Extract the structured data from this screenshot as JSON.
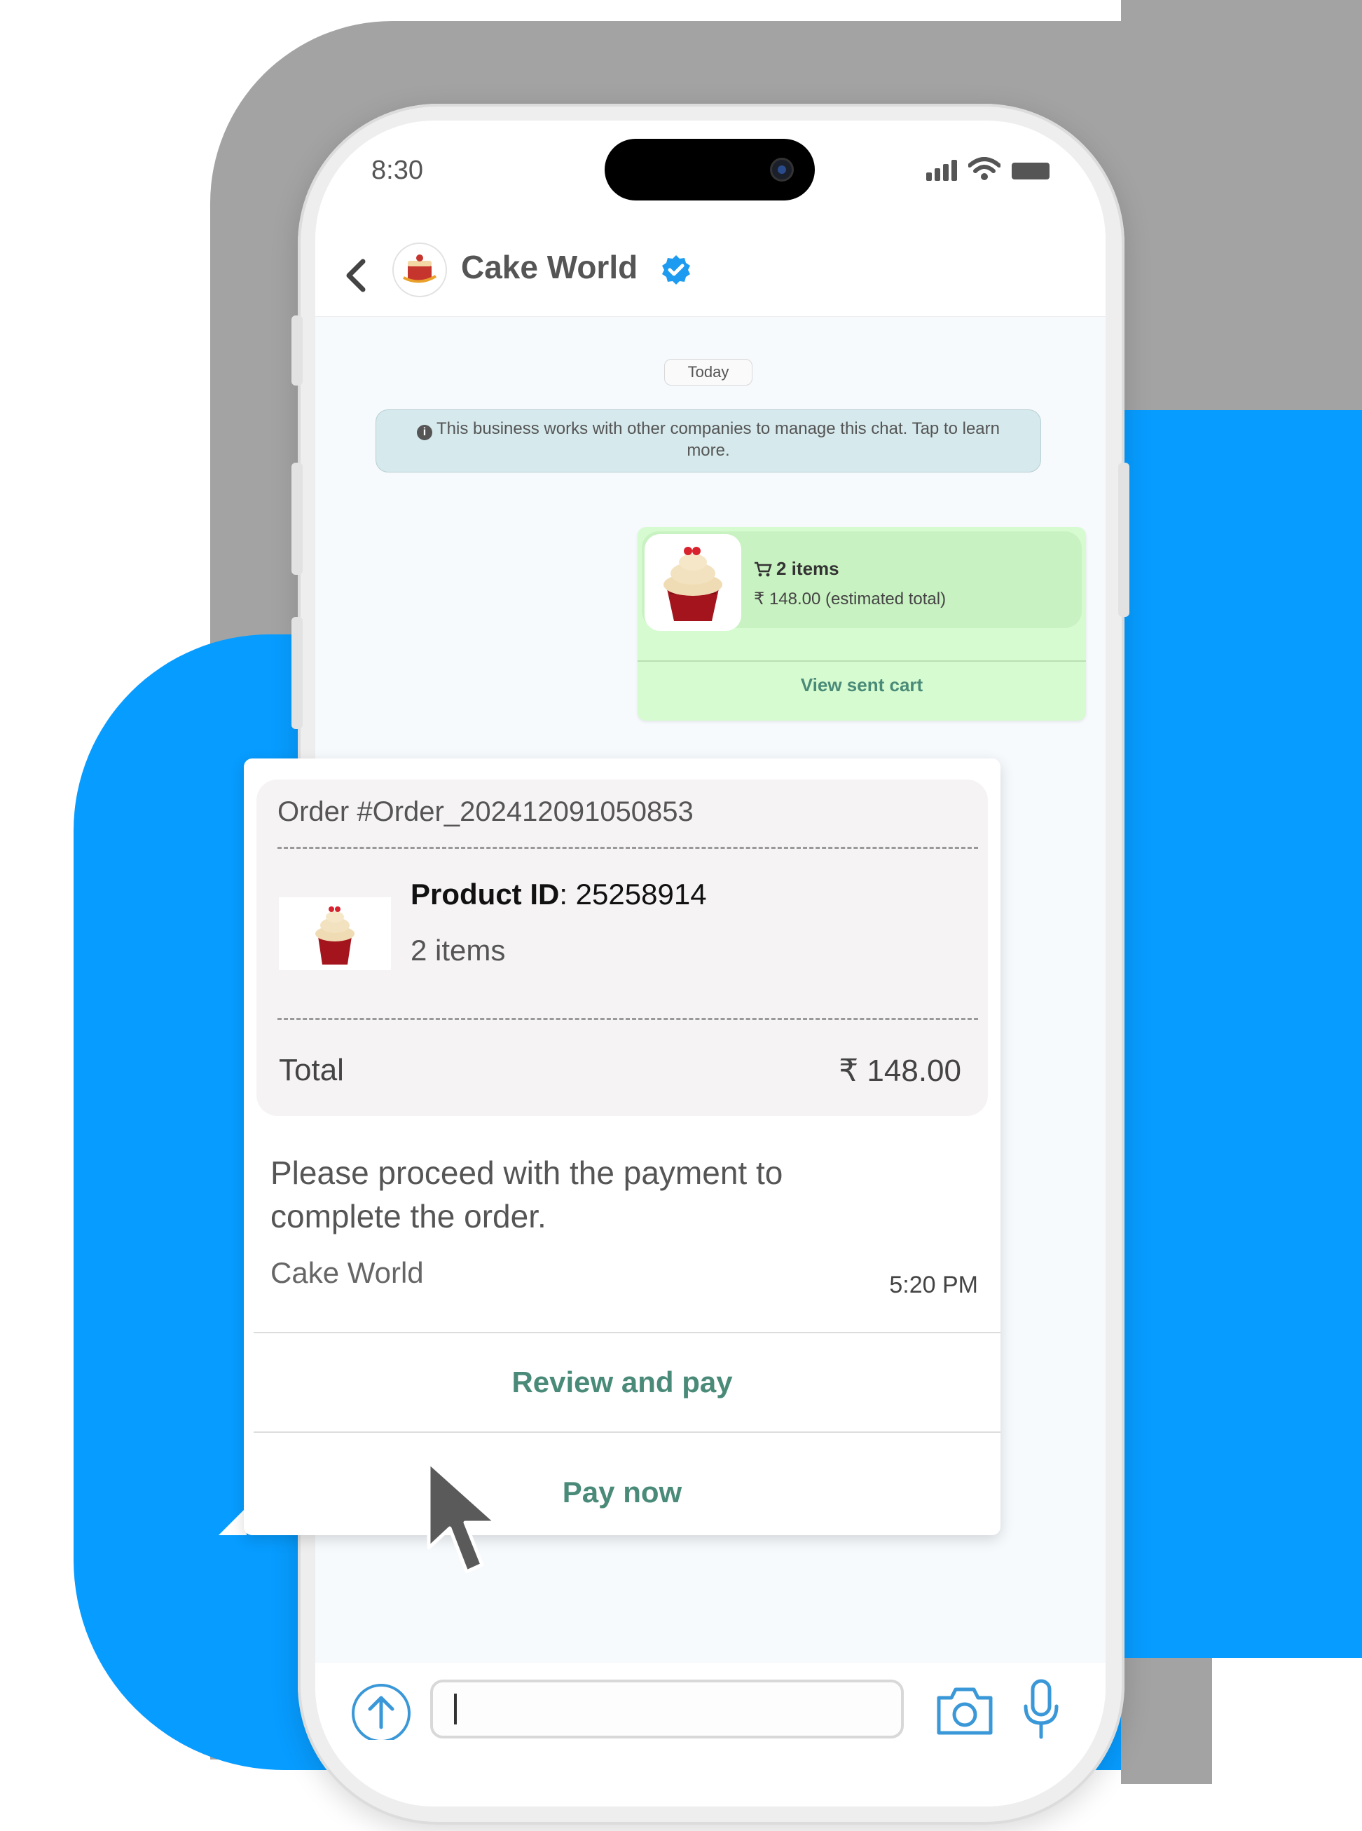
{
  "status_bar": {
    "time": "8:30"
  },
  "header": {
    "title": "Cake World",
    "back_label": "‹"
  },
  "chat": {
    "date_chip": "Today",
    "notice": "This business works with other companies to manage this chat. Tap to learn more.",
    "cart": {
      "items": "2 items",
      "price": "₹ 148.00 (estimated total)",
      "action": "View sent cart"
    },
    "order": {
      "order_no": "Order #Order_202412091050853",
      "product_id_label": "Product ID",
      "product_id_value": ": 25258914",
      "items": "2 items",
      "total_label": "Total",
      "total_value": "₹ 148.00",
      "message": "Please proceed with the payment to complete the order.",
      "sender": "Cake World",
      "time": "5:20 PM",
      "review_button": "Review and pay",
      "pay_button": "Pay now"
    }
  },
  "colors": {
    "accent_blue": "#079cff",
    "button_green": "#4a8a78",
    "cart_bubble": "#d6fbd0",
    "verified_blue": "#1d9bf0"
  }
}
